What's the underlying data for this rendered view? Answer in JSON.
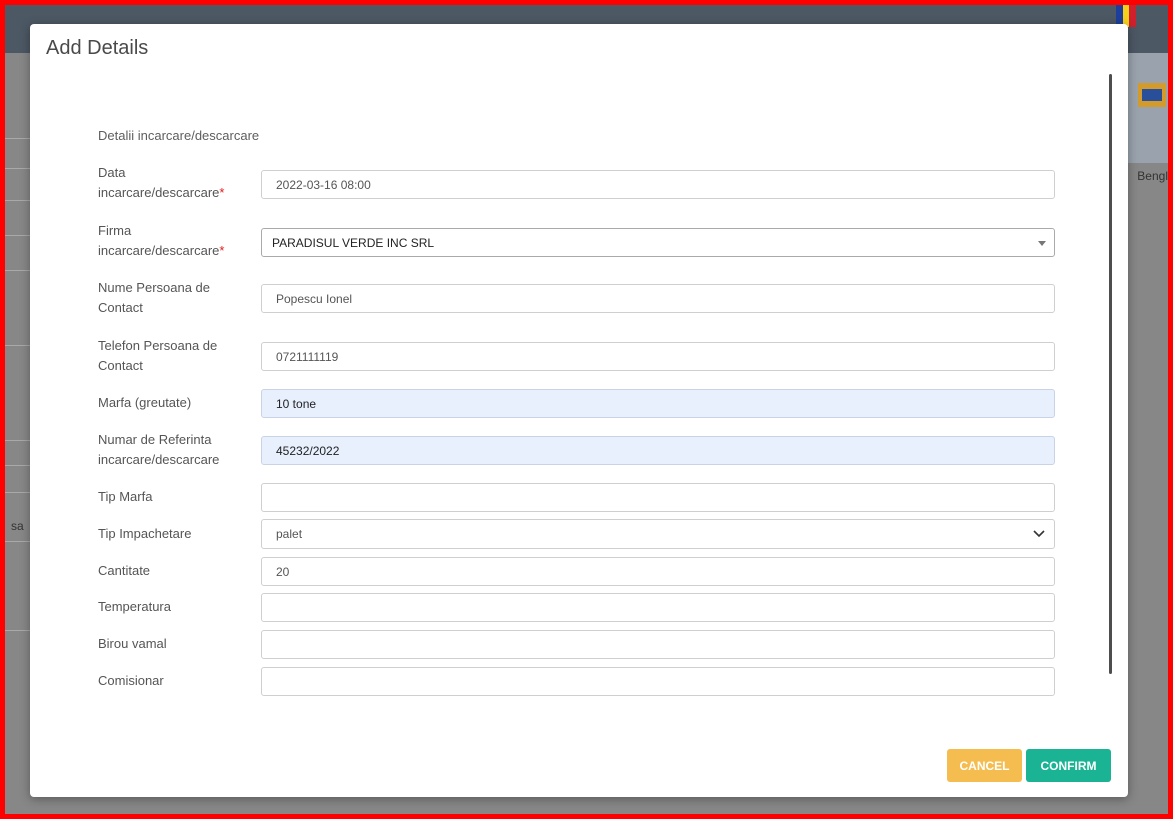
{
  "modal": {
    "title": "Add Details",
    "section_title": "Detalii incarcare/descarcare"
  },
  "fields": {
    "data": {
      "label_line1": "Data",
      "label_line2": "incarcare/descarcare",
      "required_mark": "*",
      "value": "2022-03-16 08:00"
    },
    "firma": {
      "label_line1": "Firma",
      "label_line2": "incarcare/descarcare",
      "required_mark": "*",
      "value": "PARADISUL VERDE INC SRL"
    },
    "nume_contact": {
      "label_line1": "Nume Persoana de",
      "label_line2": "Contact",
      "value": "Popescu Ionel"
    },
    "telefon_contact": {
      "label_line1": "Telefon Persoana de",
      "label_line2": "Contact",
      "value": "0721111119"
    },
    "marfa_greutate": {
      "label": "Marfa (greutate)",
      "value": "10 tone"
    },
    "numar_referinta": {
      "label_line1": "Numar de Referinta",
      "label_line2": "incarcare/descarcare",
      "value": "45232/2022"
    },
    "tip_marfa": {
      "label": "Tip Marfa",
      "value": ""
    },
    "tip_impachetare": {
      "label": "Tip Impachetare",
      "value": "palet"
    },
    "cantitate": {
      "label": "Cantitate",
      "value": "20"
    },
    "temperatura": {
      "label": "Temperatura",
      "value": ""
    },
    "birou_vamal": {
      "label": "Birou vamal",
      "value": ""
    },
    "comisionar": {
      "label": "Comisionar",
      "value": ""
    }
  },
  "buttons": {
    "cancel": "CANCEL",
    "confirm": "CONFIRM"
  },
  "background": {
    "right_text": "Bengl",
    "left_text": "sa"
  },
  "colors": {
    "cancel_button": "#f5bd4f",
    "confirm_button": "#1ab394",
    "required": "#e41a1a",
    "autofill_background": "#e8f0fe",
    "frame_border": "#ff0000"
  }
}
